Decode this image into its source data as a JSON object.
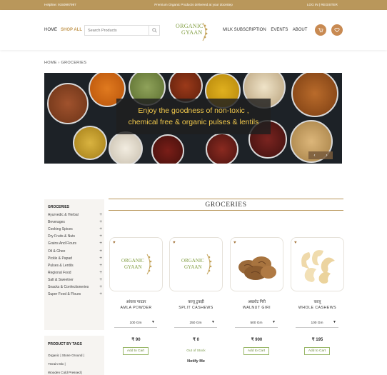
{
  "topbar": {
    "helpline": "Helpline: 9150997997",
    "promo": "Premium Organic Products delivered at your doorstep",
    "auth": "LOG IN  |  REGISTER"
  },
  "nav": {
    "home": "HOME",
    "shop_all": "SHOP ALL",
    "search_placeholder": "Search Products",
    "logo_line1": "ORGANIC",
    "logo_line2": "GYAAN",
    "milk": "MILK SUBSCRIPTION",
    "events": "EVENTS",
    "about": "ABOUT"
  },
  "breadcrumb": "HOME  ›  GROCERIES",
  "banner": {
    "line1": "Enjoy the goodness of non-toxic ,",
    "line2": "chemical free & organic pulses & lentils",
    "prev": "‹",
    "next": "›"
  },
  "sidebar": {
    "heading": "GROCERIES",
    "items": [
      "Ayurvedic & Herbal",
      "Beverages",
      "Cooking Spices",
      "Dry Fruits & Nuts",
      "Grains And Flours",
      "Oil & Ghee",
      "Pickle & Papad",
      "Pulses & Lentils",
      "Regional Food",
      "Salt & Sweetner",
      "Snacks & Confectioneries",
      "Super Food & Flours"
    ],
    "plus": "+"
  },
  "tags": {
    "heading": "PRODUCT BY TAGS",
    "t1": "Organic  |  Stone Ground  |",
    "t2": "7Grain Mix  |",
    "t3": "Wooden Cold Pressed  |"
  },
  "section_title": "GROCERIES",
  "products": [
    {
      "name_hi": "आंवला पाउडर",
      "name_en": "AMLA POWDER",
      "weight": "100 Gm",
      "price": "₹ 90",
      "action": "Add to Cart",
      "image": "logo"
    },
    {
      "name_hi": "काजू टुकड़ी",
      "name_en": "SPLIT CASHEWS",
      "weight": "250 Gm",
      "price": "₹ 0",
      "status": "Out of Stock",
      "action": "Notify Me",
      "image": "logo"
    },
    {
      "name_hi": "अखरोट गिरी",
      "name_en": "WALNUT GIRI",
      "weight": "500 Gm",
      "price": "₹ 900",
      "action": "Add to Cart",
      "image": "walnut"
    },
    {
      "name_hi": "काजू",
      "name_en": "WHOLE CASHEWS",
      "weight": "100 Gm",
      "price": "₹ 195",
      "action": "Add to Cart",
      "image": "cashew"
    }
  ],
  "colors": {
    "gold": "#b9975b",
    "orange": "#c88a52",
    "green": "#7f9c3e"
  },
  "icons": {
    "search": "search-icon",
    "cart": "cart-icon",
    "wishlist": "heart-icon",
    "dropdown": "caret-down-icon"
  }
}
